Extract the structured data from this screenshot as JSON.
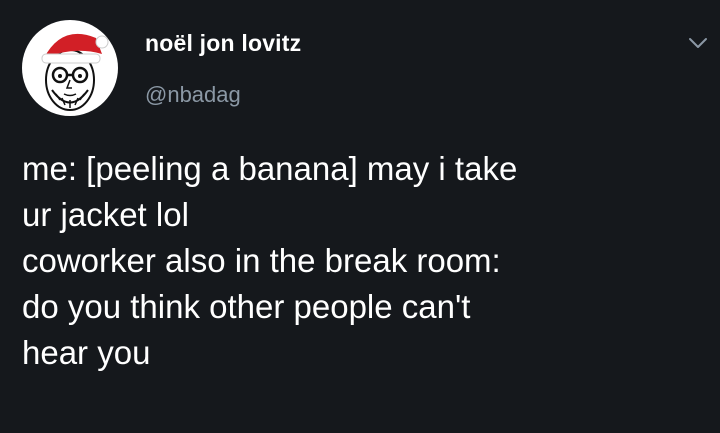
{
  "author": {
    "name": "noël jon lovitz",
    "handle": "@nbadag"
  },
  "icons": {
    "avatar": "cartoon-santa-hat-portrait",
    "menu": "chevron-down-icon"
  },
  "tweet": {
    "lines": [
      "me: [peeling a banana] may i take",
      "ur jacket lol",
      "coworker also in the break room:",
      "do you think other people can't",
      "hear you"
    ]
  },
  "colors": {
    "background": "#15181c",
    "text_primary": "#ffffff",
    "text_secondary": "#8b98a5",
    "hat_red": "#d21f26"
  }
}
